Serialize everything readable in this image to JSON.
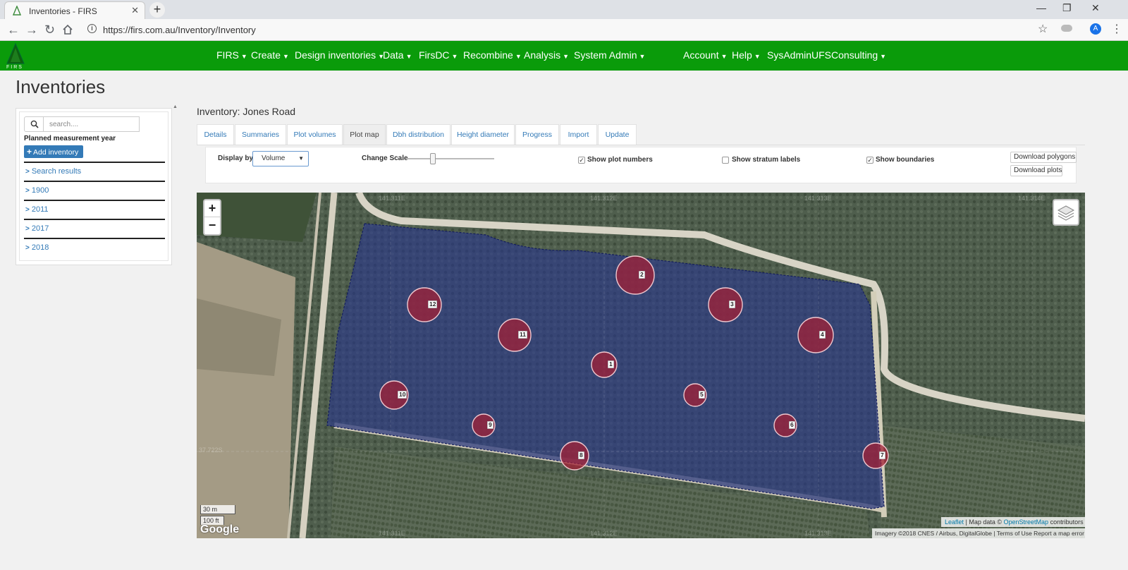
{
  "browser": {
    "tab_title": "Inventories - FIRS",
    "url": "https://firs.com.au/Inventory/Inventory",
    "profile_initial": "A"
  },
  "navbar": {
    "brand_color": "#0a9b0a",
    "menus": [
      {
        "label": "FIRS"
      },
      {
        "label": "Create"
      },
      {
        "label": "Design inventories"
      },
      {
        "label": "Data"
      },
      {
        "label": "FirsDC"
      },
      {
        "label": "Recombine"
      },
      {
        "label": "Analysis"
      },
      {
        "label": "System Admin"
      }
    ],
    "right_menus": [
      {
        "label": "Account"
      },
      {
        "label": "Help"
      },
      {
        "label": "SysAdminUFSConsulting"
      }
    ]
  },
  "page": {
    "title": "Inventories"
  },
  "sidebar": {
    "search_placeholder": "search....",
    "group_label": "Planned measurement year",
    "add_button": "Add inventory",
    "items": [
      {
        "label": "Search results"
      },
      {
        "label": "1900"
      },
      {
        "label": "2011"
      },
      {
        "label": "2017"
      },
      {
        "label": "2018"
      }
    ]
  },
  "inventory": {
    "heading": "Inventory: Jones Road",
    "tabs": [
      {
        "label": "Details"
      },
      {
        "label": "Summaries"
      },
      {
        "label": "Plot volumes"
      },
      {
        "label": "Plot map",
        "active": true
      },
      {
        "label": "Dbh distribution"
      },
      {
        "label": "Height diameter"
      },
      {
        "label": "Progress"
      },
      {
        "label": "Import"
      },
      {
        "label": "Update"
      }
    ]
  },
  "controls": {
    "display_by_label": "Display by",
    "display_by_value": "Volume",
    "change_scale_label": "Change Scale",
    "show_plot_numbers": {
      "label": "Show plot numbers",
      "checked": true
    },
    "show_stratum_labels": {
      "label": "Show stratum labels",
      "checked": false
    },
    "show_boundaries": {
      "label": "Show boundaries",
      "checked": true
    },
    "download_polygons": "Download polygons",
    "download_plots": "Download plots"
  },
  "map": {
    "boundary_color": "#1a237e",
    "plot_color": "#a22035",
    "scale_metric": "30 m",
    "scale_imperial": "100 ft",
    "google_logo": "Google",
    "attribution_leaflet": "Leaflet",
    "attribution_text": " | Map data © ",
    "attribution_osm": "OpenStreetMap",
    "attribution_tail": " contributors",
    "imagery_text": "Imagery ©2018 CNES / Airbus, DigitalGlobe  |  Terms of Use    Report a map error",
    "coord_labels": [
      "141.311E",
      "141.312E",
      "141.313E",
      "141.314E",
      "37.722S",
      "141.311E",
      "141.312E",
      "141.313E"
    ],
    "plots": [
      {
        "number": "1"
      },
      {
        "number": "2"
      },
      {
        "number": "3"
      },
      {
        "number": "4"
      },
      {
        "number": "5"
      },
      {
        "number": "6"
      },
      {
        "number": "7"
      },
      {
        "number": "8"
      },
      {
        "number": "9"
      },
      {
        "number": "10"
      },
      {
        "number": "11"
      },
      {
        "number": "12"
      }
    ]
  }
}
